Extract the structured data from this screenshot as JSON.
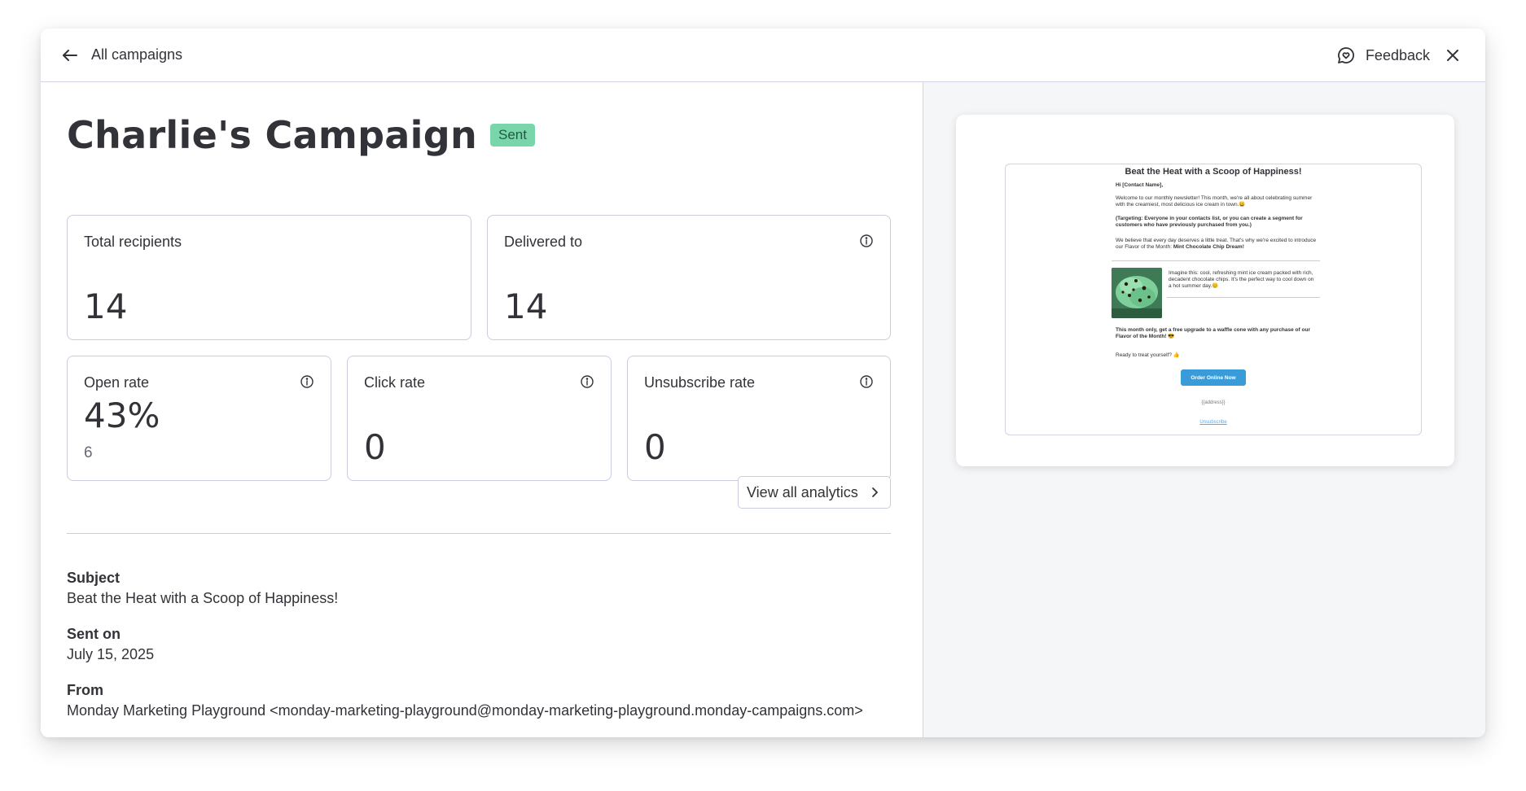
{
  "header": {
    "back_label": "All campaigns",
    "feedback_label": "Feedback"
  },
  "campaign": {
    "title": "Charlie's Campaign",
    "status": "Sent"
  },
  "stats": {
    "total_recipients": {
      "label": "Total recipients",
      "value": "14"
    },
    "delivered_to": {
      "label": "Delivered to",
      "value": "14"
    },
    "open_rate": {
      "label": "Open rate",
      "value": "43%",
      "sub": "6"
    },
    "click_rate": {
      "label": "Click rate",
      "value": "0"
    },
    "unsubscribe_rate": {
      "label": "Unsubscribe rate",
      "value": "0"
    }
  },
  "analytics_button": "View all analytics",
  "details": {
    "subject_label": "Subject",
    "subject_value": "Beat the Heat with a Scoop of Happiness!",
    "sent_on_label": "Sent on",
    "sent_on_value": "July 15, 2025",
    "from_label": "From",
    "from_value": "Monday Marketing Playground <monday-marketing-playground@monday-marketing-playground.monday-campaigns.com>"
  },
  "email_preview": {
    "title": "Beat the Heat with a Scoop of Happiness!",
    "greeting": "Hi [Contact Name],",
    "intro": "Welcome to our monthly newsletter! This month, we're all about celebrating summer with the creamiest, most delicious ice cream in town.😀",
    "targeting": "(Targeting: Everyone in your contacts list, or you can create a segment for customers who have previously purchased from you.)",
    "flavor_intro": "We believe that every day deserves a little treat. That's why we're excited to introduce our Flavor of the Month:",
    "flavor_name": "Mint Chocolate Chip Dream!",
    "image_caption": "Imagine this: cool, refreshing mint ice cream packed with rich, decadent chocolate chips. It's the perfect way to cool down on a hot summer day.😊",
    "offer": "This month only, get a free upgrade to a waffle cone with any purchase of our Flavor of the Month! 😎",
    "cta_text": "Ready to treat yourself? 👍",
    "button_label": "Order Online Now",
    "address": "{{address}}",
    "unsubscribe": "Unsubscribe"
  },
  "colors": {
    "badge_bg": "#78d6aa",
    "preview_bg": "#f5f6f8",
    "email_button": "#3a9bd9"
  }
}
